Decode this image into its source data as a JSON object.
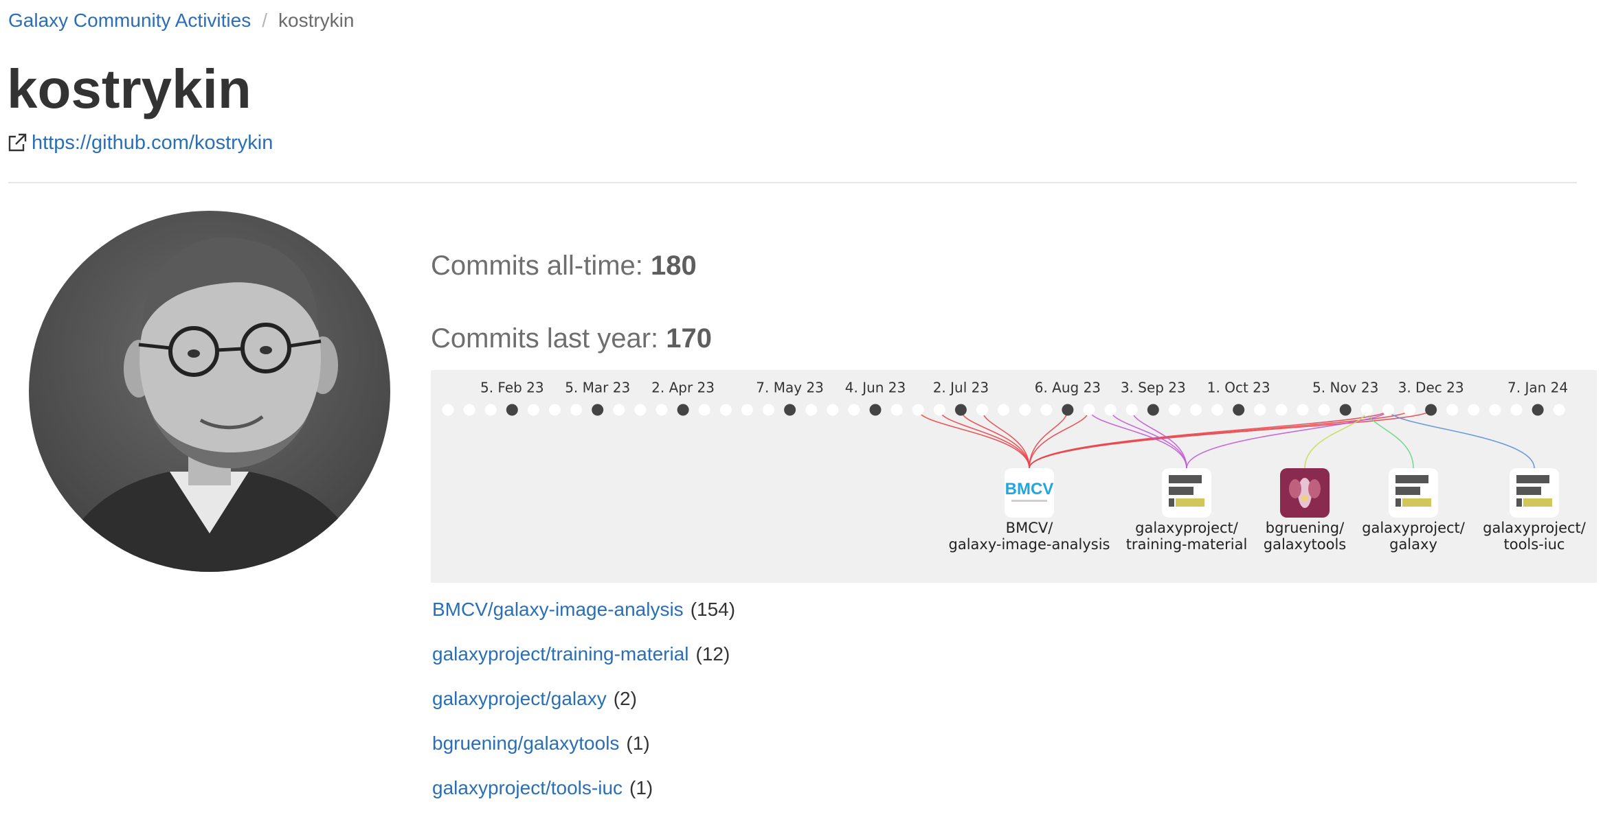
{
  "breadcrumb": {
    "parent": "Galaxy Community Activities",
    "separator": "/",
    "current": "kostrykin"
  },
  "profile": {
    "name": "kostrykin",
    "github_url": "https://github.com/kostrykin",
    "avatar_icon": "person-portrait"
  },
  "stats": {
    "all_time_label": "Commits all-time:",
    "all_time_value": "180",
    "last_year_label": "Commits last year:",
    "last_year_value": "170"
  },
  "timeline": {
    "month_labels": [
      "5. Feb 23",
      "5. Mar 23",
      "2. Apr 23",
      "7. May 23",
      "4. Jun 23",
      "2. Jul 23",
      "6. Aug 23",
      "3. Sep 23",
      "1. Oct 23",
      "5. Nov 23",
      "3. Dec 23",
      "7. Jan 24"
    ],
    "week_count": 53,
    "month_start_weeks": [
      3,
      7,
      11,
      16,
      20,
      24,
      29,
      33,
      37,
      42,
      46,
      51
    ],
    "repos": [
      {
        "name": "BMCV/galaxy-image-analysis",
        "line1": "BMCV/",
        "line2": "galaxy-image-analysis",
        "logo_text": "BMCV",
        "color": "#e8454b",
        "weeks": [
          22,
          23,
          24,
          25,
          29,
          30,
          44,
          45,
          46
        ]
      },
      {
        "name": "galaxyproject/training-material",
        "line1": "galaxyproject/",
        "line2": "training-material",
        "logo_text": "",
        "color": "#c35ad8",
        "weeks": [
          30,
          31,
          32,
          44
        ]
      },
      {
        "name": "bgruening/galaxytools",
        "line1": "bgruening/",
        "line2": "galaxytools",
        "logo_text": "",
        "color": "#c9dc5a",
        "weeks": [
          43
        ]
      },
      {
        "name": "galaxyproject/galaxy",
        "line1": "galaxyproject/",
        "line2": "galaxy",
        "logo_text": "",
        "color": "#67d68c",
        "weeks": [
          43
        ]
      },
      {
        "name": "galaxyproject/tools-iuc",
        "line1": "galaxyproject/",
        "line2": "tools-iuc",
        "logo_text": "",
        "color": "#5a8fe0",
        "weeks": [
          44
        ]
      }
    ]
  },
  "repo_list": [
    {
      "name": "BMCV/galaxy-image-analysis",
      "count": "(154)"
    },
    {
      "name": "galaxyproject/training-material",
      "count": "(12)"
    },
    {
      "name": "galaxyproject/galaxy",
      "count": "(2)"
    },
    {
      "name": "bgruening/galaxytools",
      "count": "(1)"
    },
    {
      "name": "galaxyproject/tools-iuc",
      "count": "(1)"
    }
  ],
  "colors": {
    "link": "#2a6fb5",
    "timeline_bg": "#f0f0f0",
    "dot_empty": "#ffffff",
    "dot_month": "#444444"
  }
}
